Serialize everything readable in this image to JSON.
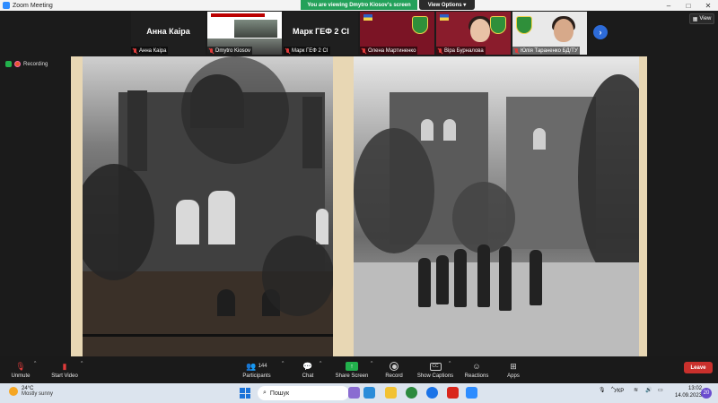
{
  "window": {
    "title": "Zoom Meeting"
  },
  "banner": {
    "viewing": "You are viewing Dmytro Kiosov's screen",
    "view_options": "View Options ▾"
  },
  "view_button": {
    "label": "View"
  },
  "recording": {
    "label": "Recording"
  },
  "participants_strip": [
    {
      "big_name": "Анна Каіра",
      "label": "Анна Каіра"
    },
    {
      "big_name": "",
      "label": "Dmytro Kiosov"
    },
    {
      "big_name": "Марк ГЕФ 2 СІ",
      "label": "Марк ГЕФ 2 СІ"
    },
    {
      "big_name": "",
      "label": "Олена Мартиненко"
    },
    {
      "big_name": "",
      "label": "Віра Бурналова"
    },
    {
      "big_name": "",
      "label": "Юлія Тараненко БД/ТУ"
    }
  ],
  "toolbar": {
    "unmute": "Unmute",
    "start_video": "Start Video",
    "participants": "Participants",
    "participants_count": "144",
    "chat": "Chat",
    "share_screen": "Share Screen",
    "record": "Record",
    "show_captions": "Show Captions",
    "reactions": "Reactions",
    "apps": "Apps",
    "leave": "Leave"
  },
  "taskbar": {
    "temperature": "24°C",
    "weather": "Mostly sunny",
    "search_placeholder": "Пошук",
    "language": "УКР",
    "time": "13:02",
    "date": "14.09.2023",
    "notifications": "20"
  }
}
